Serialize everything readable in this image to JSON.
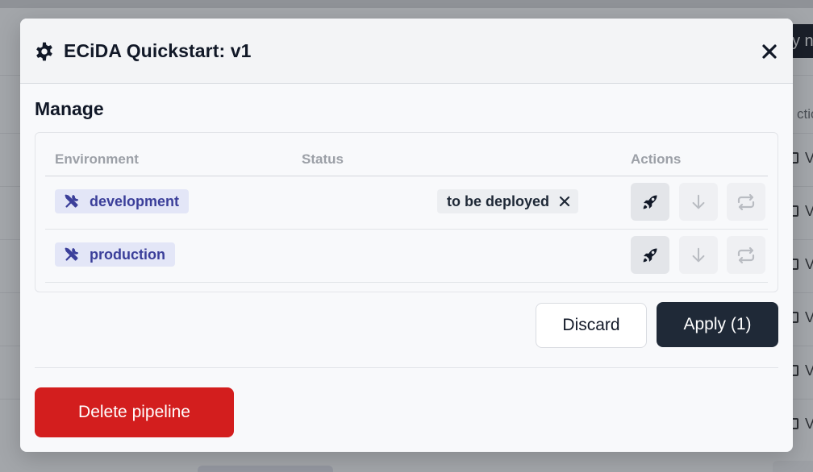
{
  "background": {
    "header_button_label": "y n",
    "column_header": "ctio",
    "row_labels": [
      "V",
      "V",
      "V",
      "V",
      "V",
      "V"
    ]
  },
  "modal": {
    "title": "ECiDA Quickstart: v1",
    "title_icon": "gear-icon",
    "close_icon": "close-icon"
  },
  "manage": {
    "heading": "Manage",
    "columns": {
      "environment": "Environment",
      "status": "Status",
      "actions": "Actions"
    },
    "rows": [
      {
        "environment": "development",
        "icon": "tools-icon",
        "status": "to be deployed",
        "actions": [
          "rocket-icon",
          "arrow-down-icon",
          "repeat-icon"
        ]
      },
      {
        "environment": "production",
        "icon": "tools-icon",
        "status": "",
        "actions": [
          "rocket-icon",
          "arrow-down-icon",
          "repeat-icon"
        ]
      }
    ]
  },
  "footer": {
    "discard_label": "Discard",
    "apply_label": "Apply (1)",
    "delete_label": "Delete pipeline"
  },
  "colors": {
    "primary_dark": "#1f2937",
    "danger": "#d31e1e",
    "env_tag_bg": "#e3e6f7",
    "env_tag_text": "#3b3f9a"
  }
}
